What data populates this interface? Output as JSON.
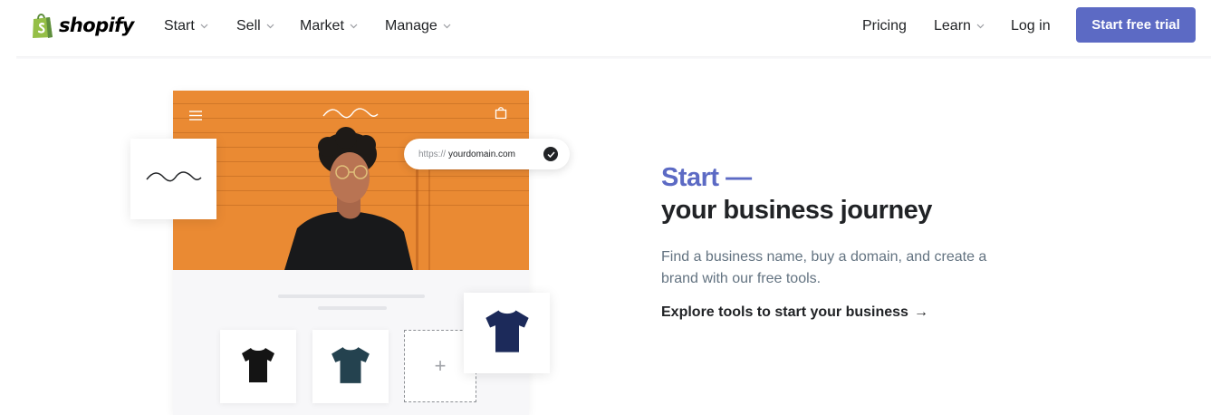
{
  "nav": {
    "logo_text": "shopify",
    "left_items": [
      {
        "label": "Start",
        "has_dropdown": true
      },
      {
        "label": "Sell",
        "has_dropdown": true
      },
      {
        "label": "Market",
        "has_dropdown": true
      },
      {
        "label": "Manage",
        "has_dropdown": true
      }
    ],
    "pricing_label": "Pricing",
    "learn_label": "Learn",
    "login_label": "Log in",
    "cta_label": "Start free trial",
    "icons": {
      "logo": "shopify-bag-icon",
      "dropdown": "chevron-down-icon"
    }
  },
  "mockup": {
    "url_protocol": "https://",
    "url_domain": "yourdomain.com",
    "icons": {
      "menu": "hamburger-menu-icon",
      "brand": "wave-logo-icon",
      "cart": "shopping-bag-icon",
      "verified": "check-circle-icon",
      "add": "plus-icon",
      "products": [
        "black-tshirt-icon",
        "teal-tshirt-icon",
        "navy-tshirt-icon"
      ]
    },
    "add_glyph": "+"
  },
  "hero": {
    "eyebrow": "Start —",
    "headline": "your business journey",
    "description": "Find a business name, buy a domain, and create a brand with our free tools.",
    "link_label": "Explore tools to start your business",
    "link_arrow": "→"
  },
  "colors": {
    "accent": "#5c6ac4",
    "text": "#212326",
    "muted": "#637381",
    "hero_orange": "#ea8a33",
    "logo_green": "#95bf47"
  }
}
